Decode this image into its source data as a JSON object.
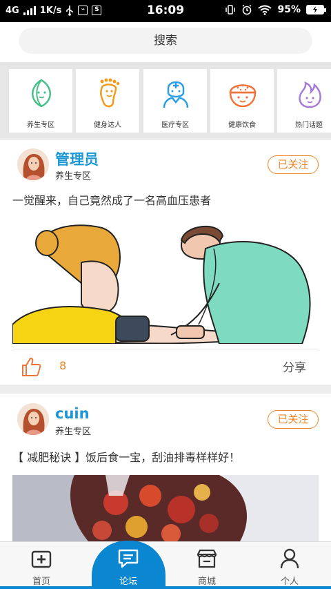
{
  "status_bar": {
    "network": "4G",
    "speed": "1K/s",
    "time": "16:09",
    "battery": "95%"
  },
  "search": {
    "label": "搜索"
  },
  "categories": [
    {
      "label": "养生专区",
      "icon": "leaf-face-icon",
      "color": "#46c08a"
    },
    {
      "label": "健身达人",
      "icon": "foot-icon",
      "color": "#f39a1c"
    },
    {
      "label": "医疗专区",
      "icon": "medical-person-icon",
      "color": "#2a9ee4"
    },
    {
      "label": "健康饮食",
      "icon": "rice-bowl-icon",
      "color": "#f0743a"
    },
    {
      "label": "热门话题",
      "icon": "flame-icon",
      "color": "#a47ad8"
    }
  ],
  "posts": [
    {
      "username": "管理员",
      "zone": "养生专区",
      "follow_label": "已关注",
      "text": "一觉醒来，自己竟然成了一名高血压患者",
      "likes": "8",
      "share_label": "分享"
    },
    {
      "username": "cuin",
      "zone": "养生专区",
      "follow_label": "已关注",
      "text": "【 减肥秘诀 】饭后食一宝，刮油排毒样样好！"
    }
  ],
  "nav": [
    {
      "label": "首页",
      "icon": "home-plus-icon",
      "active": false
    },
    {
      "label": "论坛",
      "icon": "forum-icon",
      "active": true
    },
    {
      "label": "商城",
      "icon": "shop-icon",
      "active": false
    },
    {
      "label": "个人",
      "icon": "user-icon",
      "active": false
    }
  ],
  "colors": {
    "accent": "#1a98d5",
    "follow": "#f08522",
    "nav_active": "#0b87d1"
  }
}
